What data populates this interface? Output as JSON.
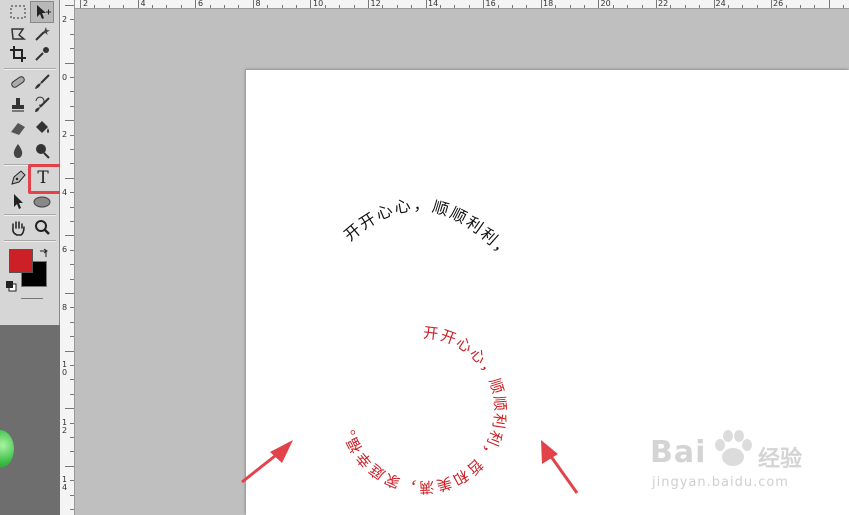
{
  "toolbar": {
    "text_tool_glyph": "T",
    "foreground_color": "#cc2026",
    "background_color": "#000000",
    "highlight_color": "#e2424a"
  },
  "ruler_vertical": {
    "labels": [
      "2",
      "0",
      "2",
      "4",
      "6",
      "8",
      "1\n0",
      "1\n2",
      "1\n4"
    ]
  },
  "ruler_horizontal": {
    "labels": [
      "2",
      "4",
      "6",
      "8",
      "10",
      "12",
      "14",
      "16",
      "18",
      "20",
      "22",
      "24",
      "26"
    ]
  },
  "canvas": {
    "arc_text": "开开心心，顺顺利利，",
    "arc_text_color": "#111111",
    "circle_text": "开开心心，顺顺利利，哲和美满，家庭幸福。",
    "circle_text_color": "#cc2026",
    "arrow_color": "#e2424a"
  },
  "watermark": {
    "brand": "Bai",
    "suffix": "经验",
    "url": "jingyan.baidu.com"
  }
}
